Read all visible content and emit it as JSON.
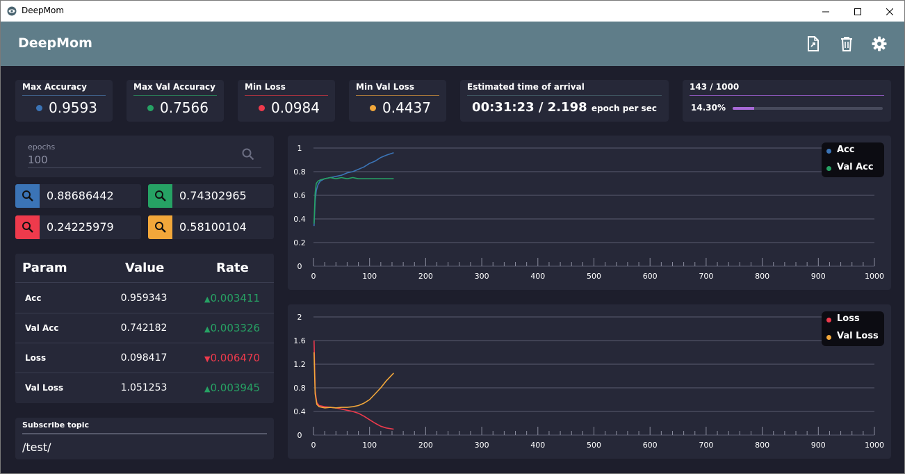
{
  "window": {
    "title": "DeepMom"
  },
  "appbar": {
    "title": "DeepMom"
  },
  "stats": [
    {
      "label": "Max Accuracy",
      "value": "0.9593",
      "color": "#3b74b6"
    },
    {
      "label": "Max Val Accuracy",
      "value": "0.7566",
      "color": "#26a264"
    },
    {
      "label": "Min Loss",
      "value": "0.0984",
      "color": "#ee3a4c"
    },
    {
      "label": "Min Val Loss",
      "value": "0.4437",
      "color": "#f2a73a"
    }
  ],
  "eta": {
    "label": "Estimated time of arrival",
    "value": "00:31:23 / 2.198",
    "unit": "epoch per sec"
  },
  "progress": {
    "label": "143 / 1000",
    "percent_text": "14.30%",
    "fraction": 0.143
  },
  "epochs": {
    "label": "epochs",
    "value": "100"
  },
  "queries": [
    {
      "value": "0.88686442",
      "color": "#3b74b6"
    },
    {
      "value": "0.74302965",
      "color": "#26a264"
    },
    {
      "value": "0.24225979",
      "color": "#ee3a4c"
    },
    {
      "value": "0.58100104",
      "color": "#f2a73a"
    }
  ],
  "param_table": {
    "headers": [
      "Param",
      "Value",
      "Rate"
    ],
    "rows": [
      {
        "param": "Acc",
        "value": "0.959343",
        "rate": "0.003411",
        "direction": "up"
      },
      {
        "param": "Val Acc",
        "value": "0.742182",
        "rate": "0.003326",
        "direction": "up"
      },
      {
        "param": "Loss",
        "value": "0.098417",
        "rate": "0.006470",
        "direction": "down"
      },
      {
        "param": "Val Loss",
        "value": "1.051253",
        "rate": "0.003945",
        "direction": "up"
      }
    ]
  },
  "subscribe": {
    "label": "Subscribe topic",
    "value": "/test/"
  },
  "chart_data": [
    {
      "type": "line",
      "xlim": [
        0,
        1000
      ],
      "ylim": [
        0,
        1
      ],
      "xticks": [
        "0",
        "100",
        "200",
        "300",
        "400",
        "500",
        "600",
        "700",
        "800",
        "900",
        "1000"
      ],
      "yticks": [
        "0",
        "0.2",
        "0.4",
        "0.6",
        "0.8",
        "1"
      ],
      "legend_position": "top-right",
      "grid": true,
      "series": [
        {
          "name": "Acc",
          "color": "#3b74b6",
          "x": [
            1,
            3,
            5,
            8,
            12,
            20,
            30,
            40,
            50,
            60,
            70,
            80,
            90,
            100,
            110,
            120,
            130,
            143
          ],
          "y": [
            0.34,
            0.55,
            0.64,
            0.69,
            0.72,
            0.74,
            0.75,
            0.76,
            0.77,
            0.79,
            0.8,
            0.82,
            0.84,
            0.87,
            0.89,
            0.92,
            0.94,
            0.96
          ]
        },
        {
          "name": "Val Acc",
          "color": "#26a264",
          "x": [
            1,
            3,
            5,
            8,
            12,
            20,
            30,
            40,
            50,
            60,
            70,
            80,
            90,
            100,
            110,
            120,
            130,
            143
          ],
          "y": [
            0.36,
            0.62,
            0.7,
            0.72,
            0.73,
            0.74,
            0.75,
            0.74,
            0.75,
            0.74,
            0.75,
            0.74,
            0.74,
            0.74,
            0.74,
            0.74,
            0.74,
            0.74
          ]
        }
      ]
    },
    {
      "type": "line",
      "xlim": [
        0,
        1000
      ],
      "ylim": [
        0,
        2
      ],
      "xticks": [
        "0",
        "100",
        "200",
        "300",
        "400",
        "500",
        "600",
        "700",
        "800",
        "900",
        "1000"
      ],
      "yticks": [
        "0",
        "0.4",
        "0.8",
        "1.2",
        "1.6",
        "2"
      ],
      "legend_position": "top-right",
      "grid": true,
      "series": [
        {
          "name": "Loss",
          "color": "#ee3a4c",
          "x": [
            1,
            3,
            6,
            10,
            20,
            30,
            40,
            50,
            60,
            70,
            80,
            90,
            100,
            110,
            120,
            130,
            143
          ],
          "y": [
            1.6,
            0.75,
            0.55,
            0.5,
            0.48,
            0.47,
            0.46,
            0.44,
            0.42,
            0.4,
            0.37,
            0.32,
            0.26,
            0.2,
            0.15,
            0.12,
            0.1
          ]
        },
        {
          "name": "Val Loss",
          "color": "#f2a73a",
          "x": [
            1,
            3,
            6,
            10,
            20,
            30,
            40,
            50,
            60,
            70,
            80,
            90,
            100,
            110,
            120,
            130,
            143
          ],
          "y": [
            1.4,
            0.7,
            0.52,
            0.48,
            0.46,
            0.47,
            0.46,
            0.47,
            0.47,
            0.48,
            0.5,
            0.54,
            0.6,
            0.7,
            0.8,
            0.92,
            1.05
          ]
        }
      ]
    }
  ]
}
